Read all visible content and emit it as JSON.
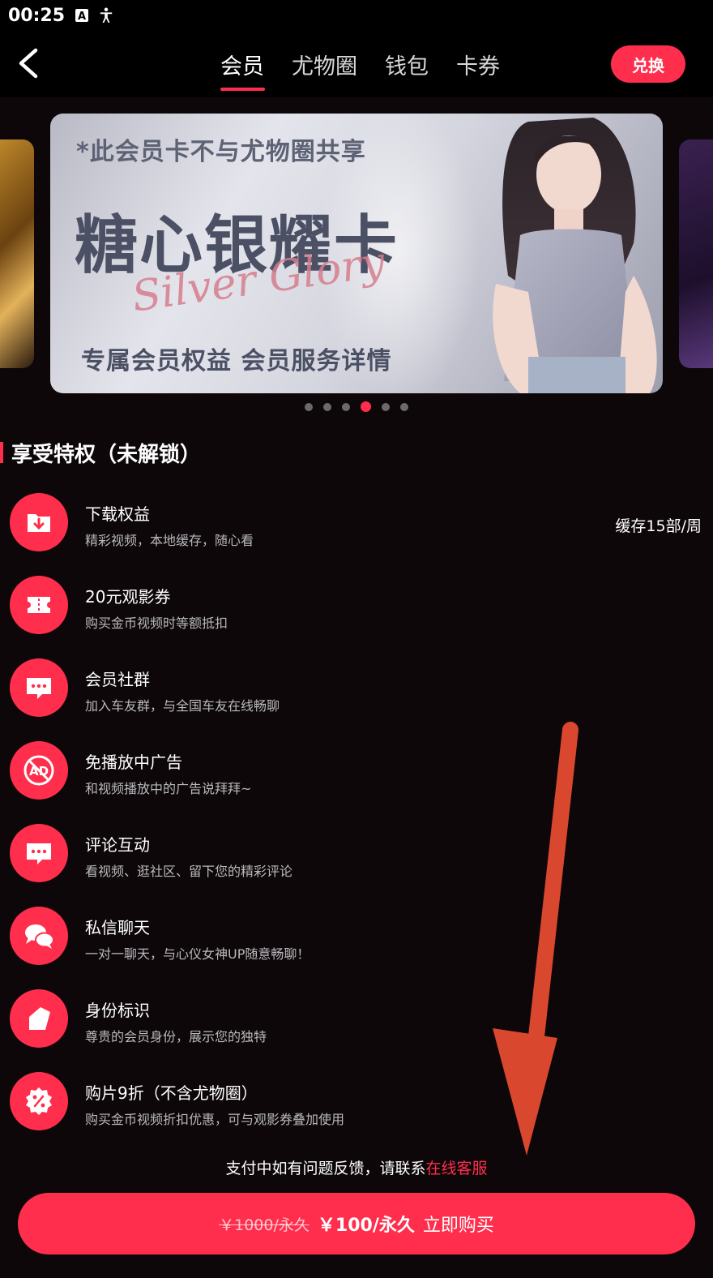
{
  "status_bar": {
    "time": "00:25"
  },
  "header": {
    "tabs": [
      {
        "label": "会员",
        "active": true
      },
      {
        "label": "尤物圈",
        "active": false
      },
      {
        "label": "钱包",
        "active": false
      },
      {
        "label": "卡券",
        "active": false
      }
    ],
    "exchange_label": "兑换"
  },
  "banner": {
    "notice": "*此会员卡不与尤物圈共享",
    "title": "糖心银耀卡",
    "script": "Silver Glory",
    "subtitle": "专属会员权益  会员服务详情",
    "dot_count": 6,
    "active_dot": 3
  },
  "section": {
    "title": "享受特权（未解锁）"
  },
  "perks": [
    {
      "title": "下载权益",
      "desc": "精彩视频，本地缓存，随心看",
      "extra": "缓存15部/周",
      "icon": "download-icon"
    },
    {
      "title": "20元观影券",
      "desc": "购买金币视频时等额抵扣",
      "extra": "",
      "icon": "ticket-icon"
    },
    {
      "title": "会员社群",
      "desc": "加入车友群，与全国车友在线畅聊",
      "extra": "",
      "icon": "chat-bubble-icon"
    },
    {
      "title": "免播放中广告",
      "desc": "和视频播放中的广告说拜拜~",
      "extra": "",
      "icon": "no-ads-icon"
    },
    {
      "title": "评论互动",
      "desc": "看视频、逛社区、留下您的精彩评论",
      "extra": "",
      "icon": "comment-icon"
    },
    {
      "title": "私信聊天",
      "desc": "一对一聊天，与心仪女神UP随意畅聊！",
      "extra": "",
      "icon": "private-chat-icon"
    },
    {
      "title": "身份标识",
      "desc": "尊贵的会员身份，展示您的独特",
      "extra": "",
      "icon": "badge-tag-icon"
    },
    {
      "title": "购片9折（不含尤物圈）",
      "desc": "购买金币视频折扣优惠，可与观影券叠加使用",
      "extra": "",
      "icon": "discount-icon"
    }
  ],
  "footer": {
    "note_prefix": "支付中如有问题反馈，请联系",
    "note_link": "在线客服",
    "old_price": "￥1000/永久",
    "new_price": "￥100/永久",
    "buy_label": "立即购买"
  },
  "colors": {
    "accent": "#ff2e4d",
    "background": "#0d0709"
  }
}
